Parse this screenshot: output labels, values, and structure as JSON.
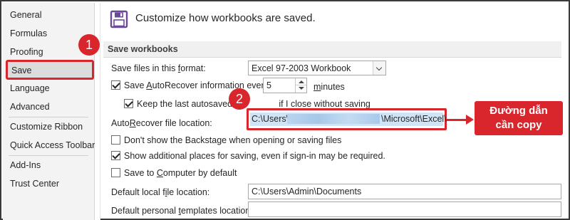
{
  "sidebar": {
    "items": [
      {
        "label": "General"
      },
      {
        "label": "Formulas"
      },
      {
        "label": "Proofing"
      },
      {
        "label": "Save"
      },
      {
        "label": "Language"
      },
      {
        "label": "Advanced"
      },
      {
        "label": "Customize Ribbon"
      },
      {
        "label": "Quick Access Toolbar"
      },
      {
        "label": "Add-Ins"
      },
      {
        "label": "Trust Center"
      }
    ],
    "selected": "Save"
  },
  "header": {
    "icon": "floppy-disk-icon",
    "title": "Customize how workbooks are saved."
  },
  "section": {
    "title": "Save workbooks"
  },
  "options": {
    "format_label_pre": "Save files in this ",
    "format_label_u": "f",
    "format_label_post": "ormat:",
    "format_value": "Excel 97-2003 Workbook",
    "autorecover_pre": "Save ",
    "autorecover_u": "A",
    "autorecover_post": "utoRecover information every",
    "autorecover_checked": true,
    "autorecover_minutes": "5",
    "minutes_u": "m",
    "minutes_post": "inutes",
    "keep_last_pre": "Keep the last autosaved v",
    "keep_last_post": " if I close without saving",
    "keep_last_checked": true,
    "ar_location_pre": "Auto",
    "ar_location_u": "R",
    "ar_location_post": "ecover file location:",
    "ar_location_value_start": "C:\\Users\\",
    "ar_location_value_end": "\\Microsoft\\Excel\\",
    "backstage_label": "Don't show the Backstage when opening or saving files",
    "backstage_checked": false,
    "additional_places_label": "Show additional places for saving, even if sign-in may be required.",
    "additional_places_checked": true,
    "save_computer_pre": "Save to ",
    "save_computer_u": "C",
    "save_computer_post": "omputer by default",
    "save_computer_checked": false,
    "default_local_pre": "Default local f",
    "default_local_u": "i",
    "default_local_post": "le location:",
    "default_local_value": "C:\\Users\\Admin\\Documents",
    "default_templates_pre": "Default personal ",
    "default_templates_u": "t",
    "default_templates_post": "emplates location:",
    "default_templates_value": ""
  },
  "annotations": {
    "badge1": "1",
    "badge2": "2",
    "callout_line1": "Đường dẫn",
    "callout_line2": "cần copy",
    "accent_color": "#d9252c"
  }
}
